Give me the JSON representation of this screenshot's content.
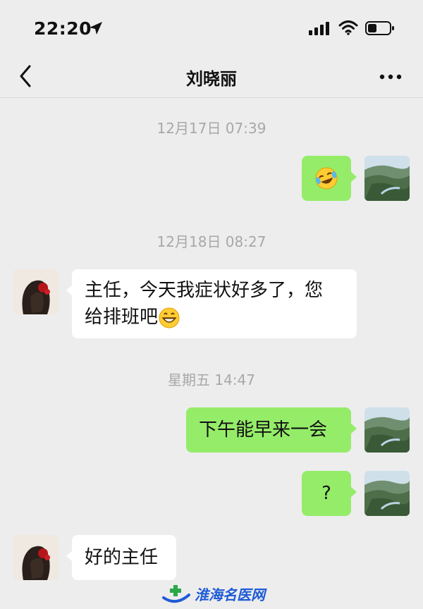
{
  "status_bar": {
    "time": "22:20"
  },
  "header": {
    "title": "刘晓丽"
  },
  "messages": [
    {
      "type": "timestamp",
      "text": "12月17日 07:39"
    },
    {
      "type": "sent",
      "emoji": "face-with-tears-of-joy-icon"
    },
    {
      "type": "timestamp",
      "text": "12月18日 08:27"
    },
    {
      "type": "received",
      "line1": "主任，今天我症状好多了，您",
      "line2": "给排班吧",
      "emoji": "grinning-face-icon"
    },
    {
      "type": "timestamp",
      "text": "星期五 14:47"
    },
    {
      "type": "sent",
      "text": "下午能早来一会"
    },
    {
      "type": "sent",
      "text": "?"
    },
    {
      "type": "received",
      "text": "好的主任"
    }
  ],
  "watermark": {
    "text": "淮海名医网"
  },
  "colors": {
    "sent_bubble": "#95ec69",
    "received_bubble": "#ffffff",
    "background": "#ededed",
    "timestamp": "#a8a8a8"
  }
}
